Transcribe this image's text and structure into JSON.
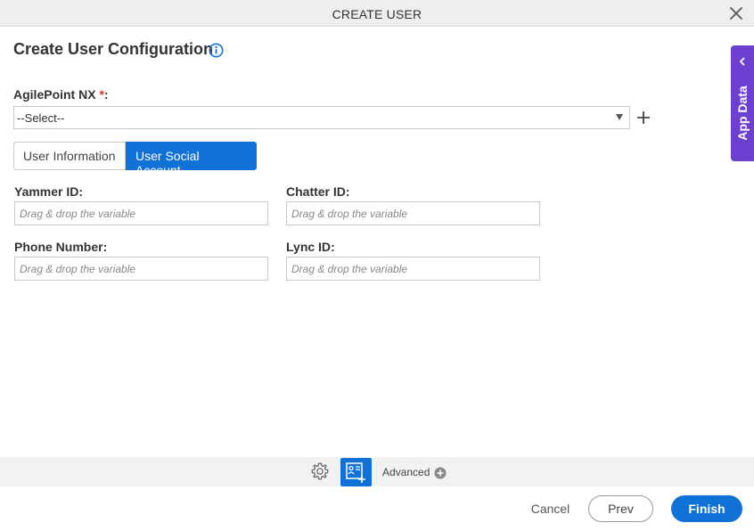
{
  "window": {
    "title": "CREATE USER"
  },
  "header": {
    "heading": "Create User Configuration"
  },
  "agilepoint": {
    "label": "AgilePoint NX",
    "required_mark": "*",
    "suffix": ":",
    "selected": "--Select--"
  },
  "tabs": [
    {
      "label": "User Information",
      "active": false
    },
    {
      "label": "User Social Account",
      "active": true
    }
  ],
  "fields": {
    "yammer": {
      "label": "Yammer ID:",
      "placeholder": "Drag & drop the variable"
    },
    "chatter": {
      "label": "Chatter ID:",
      "placeholder": "Drag & drop the variable"
    },
    "phone": {
      "label": "Phone Number:",
      "placeholder": "Drag & drop the variable"
    },
    "lync": {
      "label": "Lync ID:",
      "placeholder": "Drag & drop the variable"
    }
  },
  "toolbar": {
    "advanced_label": "Advanced"
  },
  "footer": {
    "cancel_label": "Cancel",
    "prev_label": "Prev",
    "finish_label": "Finish"
  },
  "side_panel": {
    "label": "App Data"
  },
  "icons": {
    "close": "close-icon",
    "info": "info-icon",
    "add": "plus-icon",
    "settings": "gear-icon",
    "form": "user-form-icon",
    "advanced": "plus-circle-icon",
    "collapse": "chevron-left-icon"
  },
  "colors": {
    "accent": "#1072d7",
    "side_panel": "#6d3fd0",
    "required": "#d9332c"
  }
}
